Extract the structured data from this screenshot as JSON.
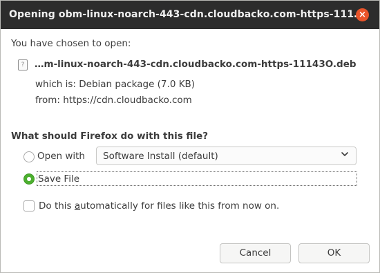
{
  "window": {
    "title": "Opening obm-linux-noarch-443-cdn.cloudbacko.com-https-111…",
    "close_glyph": "×"
  },
  "info": {
    "chosen_label": "You have chosen to open:",
    "file_icon": "file-unknown-icon",
    "file_icon_glyph": "?",
    "filename": "…m-linux-noarch-443-cdn.cloudbacko.com-https-11143O.deb",
    "which_is": "which is:  Debian package (7.0 KB)",
    "from": "from:  https://cdn.cloudbacko.com"
  },
  "action": {
    "question": "What should Firefox do with this file?",
    "open_with_label": "Open with",
    "open_with_app": "Software Install (default)",
    "chevron_glyph": "⌄",
    "save_file_label": "Save File",
    "selected": "save_file"
  },
  "auto": {
    "label_prefix": "Do this ",
    "label_underlined": "a",
    "label_suffix": "utomatically for files like this from now on.",
    "checked": false
  },
  "buttons": {
    "cancel": "Cancel",
    "ok": "OK"
  },
  "colors": {
    "titlebar": "#2c2c2c",
    "close": "#e9542a",
    "radio_selected": "#4caf2f"
  }
}
